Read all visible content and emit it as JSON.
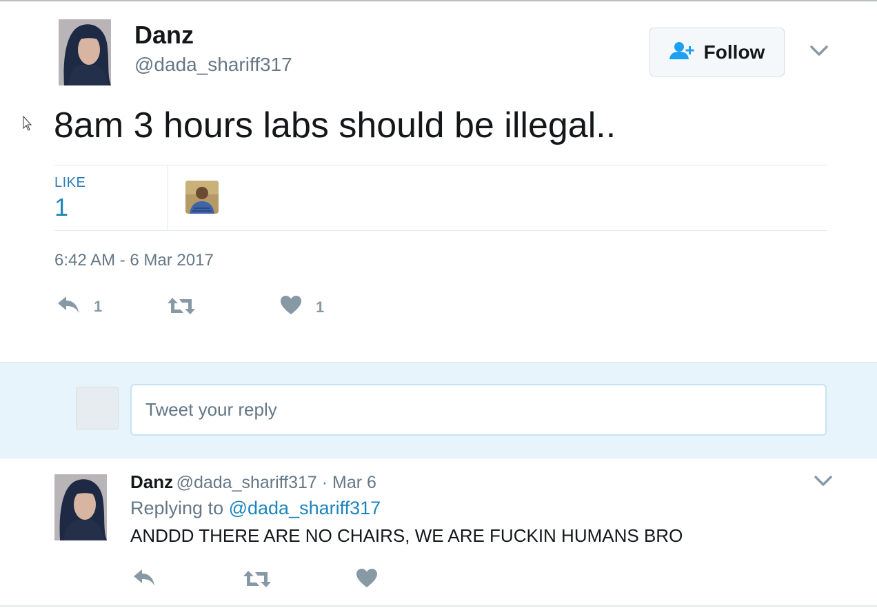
{
  "tweet": {
    "author_name": "Danz",
    "author_handle": "@dada_shariff317",
    "follow_label": "Follow",
    "text": "8am 3 hours labs should be illegal..",
    "like_label": "LIKE",
    "like_count": "1",
    "timestamp": "6:42 AM - 6 Mar 2017",
    "reply_count": "1",
    "retweet_count": "",
    "heart_count": "1"
  },
  "reply_box": {
    "placeholder": "Tweet your reply"
  },
  "reply": {
    "author_name": "Danz",
    "author_handle": "@dada_shariff317",
    "separator": " · ",
    "date": "Mar 6",
    "replying_prefix": "Replying to ",
    "replying_to": "@dada_shariff317",
    "text": "ANDDD THERE ARE NO CHAIRS, WE ARE FUCKIN HUMANS BRO"
  },
  "colors": {
    "accent": "#1b85bb",
    "muted": "#657786",
    "icon": "#8899a6",
    "reply_bg": "#e8f4fb"
  },
  "icons": {
    "follow": "add-user-icon",
    "menu": "chevron-down-icon",
    "reply": "reply-icon",
    "retweet": "retweet-icon",
    "like": "heart-icon"
  }
}
